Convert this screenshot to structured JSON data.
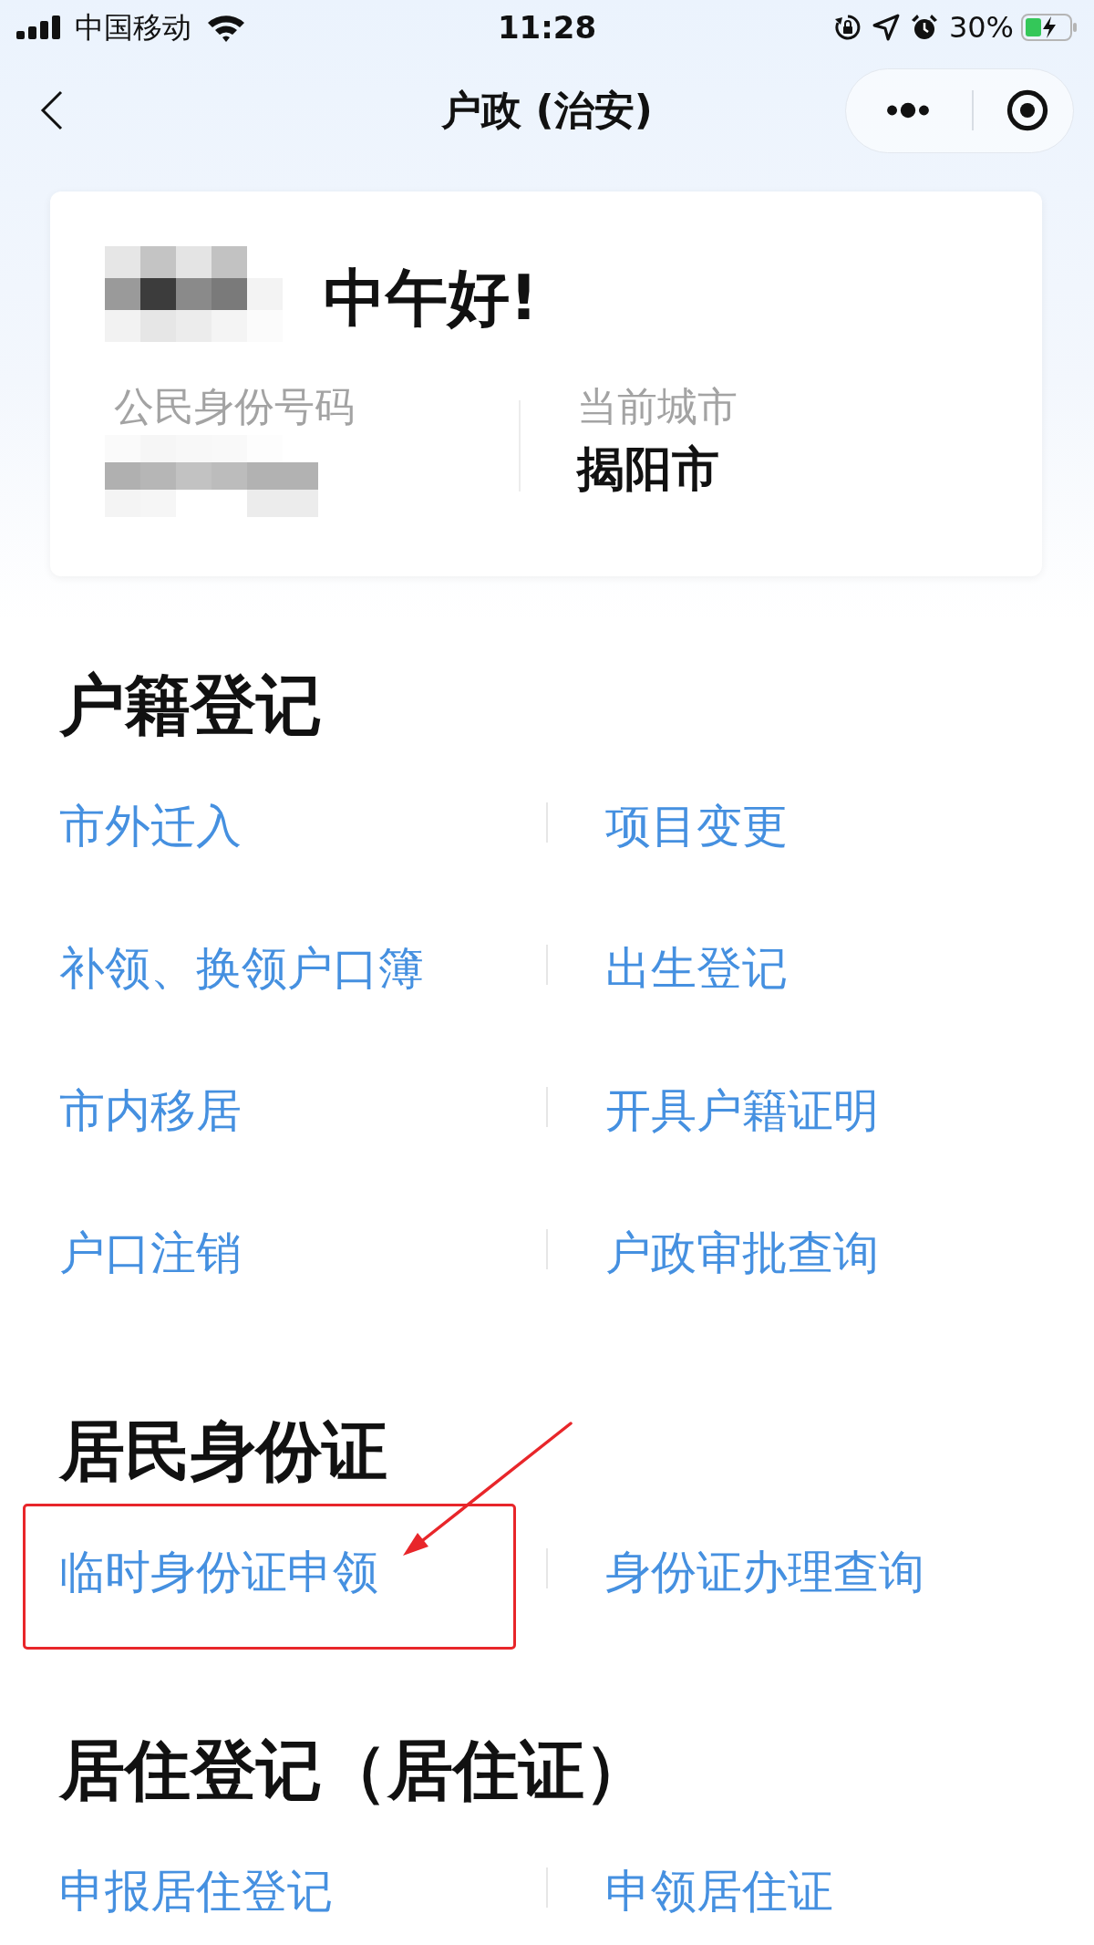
{
  "status_bar": {
    "carrier": "中国移动",
    "time": "11:28",
    "battery": "30%"
  },
  "nav_bar": {
    "title": "户政 (治安)"
  },
  "profile_card": {
    "greeting": "中午好!",
    "id_label": "公民身份号码",
    "city_label": "当前城市",
    "city": "揭阳市"
  },
  "sections": [
    {
      "title": "户籍登记",
      "links": [
        {
          "label": "市外迁入",
          "highlighted": false
        },
        {
          "label": "项目变更",
          "highlighted": false
        },
        {
          "label": "补领、换领户口簿",
          "highlighted": false
        },
        {
          "label": "出生登记",
          "highlighted": false
        },
        {
          "label": "市内移居",
          "highlighted": false
        },
        {
          "label": "开具户籍证明",
          "highlighted": false
        },
        {
          "label": "户口注销",
          "highlighted": false
        },
        {
          "label": "户政审批查询",
          "highlighted": false
        }
      ]
    },
    {
      "title": "居民身份证",
      "links": [
        {
          "label": "临时身份证申领",
          "highlighted": true
        },
        {
          "label": "身份证办理查询",
          "highlighted": false
        }
      ]
    },
    {
      "title": "居住登记（居住证）",
      "links": [
        {
          "label": "申报居住登记",
          "highlighted": false
        },
        {
          "label": "申领居住证",
          "highlighted": false
        }
      ]
    }
  ]
}
